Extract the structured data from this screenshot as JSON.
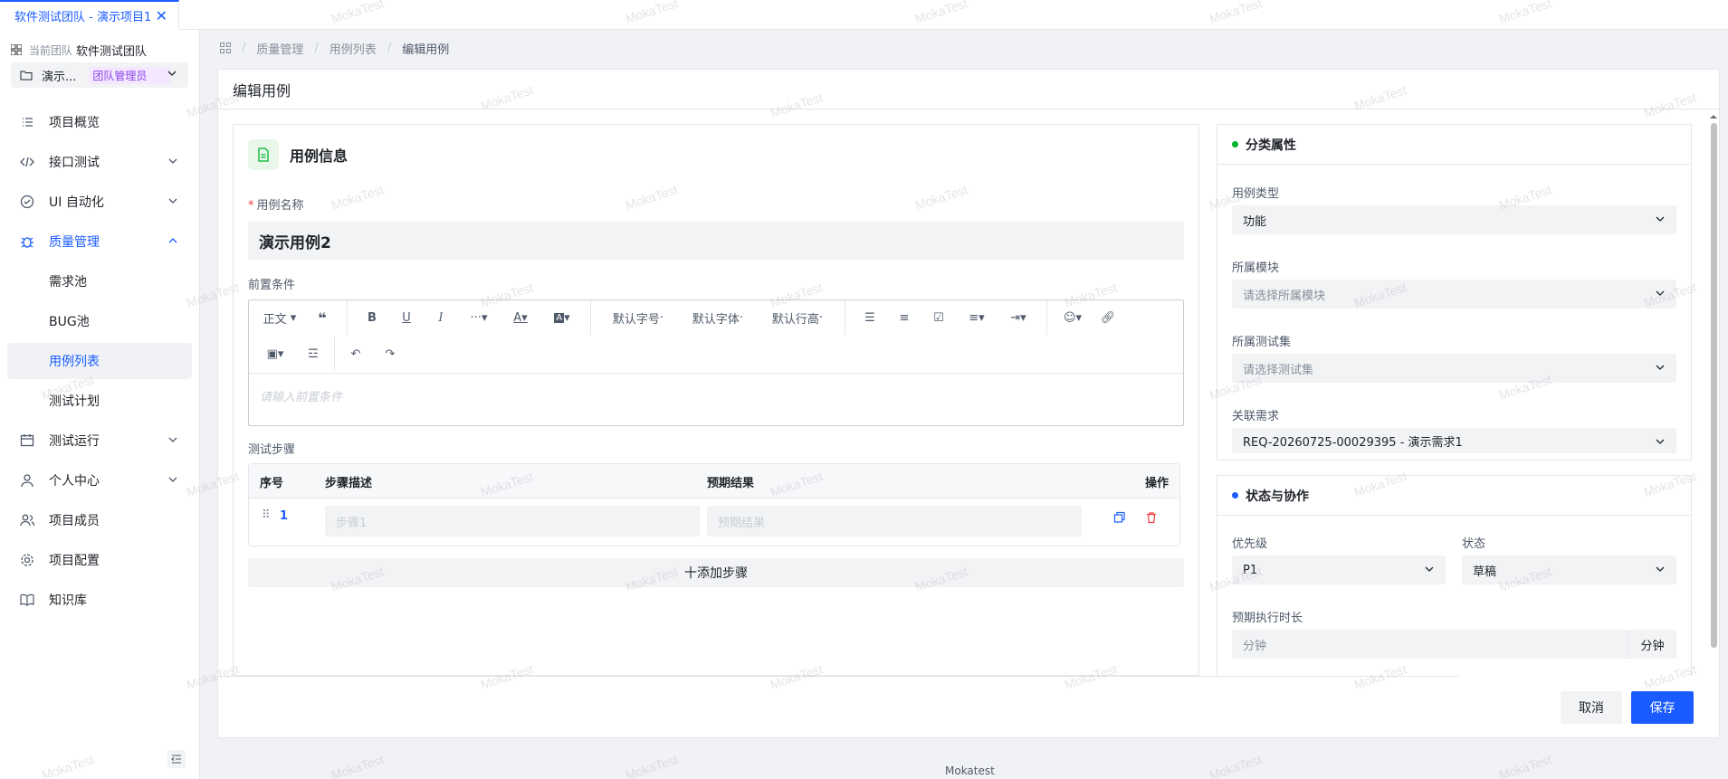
{
  "tab": {
    "title": "软件测试团队 - 演示项目1",
    "close": "✕"
  },
  "sidebar": {
    "team_label": "当前团队",
    "team_name": "软件测试团队",
    "project_name": "演示...",
    "project_role": "团队管理员",
    "items": [
      {
        "label": "项目概览",
        "icon": "list-icon"
      },
      {
        "label": "接口测试",
        "icon": "code-icon"
      },
      {
        "label": "UI 自动化",
        "icon": "check-circle-icon"
      },
      {
        "label": "质量管理",
        "icon": "bug-icon"
      },
      {
        "label": "需求池"
      },
      {
        "label": "BUG池"
      },
      {
        "label": "用例列表"
      },
      {
        "label": "测试计划"
      },
      {
        "label": "测试运行",
        "icon": "calendar-icon"
      },
      {
        "label": "个人中心",
        "icon": "user-icon"
      },
      {
        "label": "项目成员",
        "icon": "users-icon"
      },
      {
        "label": "项目配置",
        "icon": "gear-icon"
      },
      {
        "label": "知识库",
        "icon": "book-icon"
      }
    ]
  },
  "breadcrumb": {
    "items": [
      "质量管理",
      "用例列表",
      "编辑用例"
    ]
  },
  "page": {
    "title": "编辑用例"
  },
  "case_info": {
    "section_title": "用例信息",
    "name_label": "用例名称",
    "name_value": "演示用例2",
    "precondition_label": "前置条件",
    "editor_placeholder": "请输入前置条件",
    "toolbar": {
      "paragraph": "正文",
      "font_size": "默认字号",
      "font_family": "默认字体",
      "line_height": "默认行高",
      "more": "···"
    },
    "steps_label": "测试步骤",
    "steps_columns": [
      "序号",
      "步骤描述",
      "预期结果",
      "操作"
    ],
    "steps": [
      {
        "num": "1",
        "desc_placeholder": "步骤1",
        "expected_placeholder": "预期结果"
      }
    ],
    "add_step": "十添加步骤"
  },
  "classify": {
    "title": "分类属性",
    "dot_color": "#00b42a",
    "type_label": "用例类型",
    "type_value": "功能",
    "module_label": "所属模块",
    "module_placeholder": "请选择所属模块",
    "suite_label": "所属测试集",
    "suite_placeholder": "请选择测试集",
    "req_label": "关联需求",
    "req_value": "REQ-20260725-00029395 - 演示需求1"
  },
  "status": {
    "title": "状态与协作",
    "dot_color": "#1a5cff",
    "priority_label": "优先级",
    "priority_value": "P1",
    "state_label": "状态",
    "state_value": "草稿",
    "duration_label": "预期执行时长",
    "duration_placeholder": "分钟",
    "duration_unit": "分钟"
  },
  "actions": {
    "cancel": "取消",
    "save": "保存"
  },
  "footer": {
    "brand": "Mokatest"
  },
  "watermark": "MokaTest",
  "colors": {
    "accent": "#1a5cff",
    "danger": "#f53f3f"
  }
}
